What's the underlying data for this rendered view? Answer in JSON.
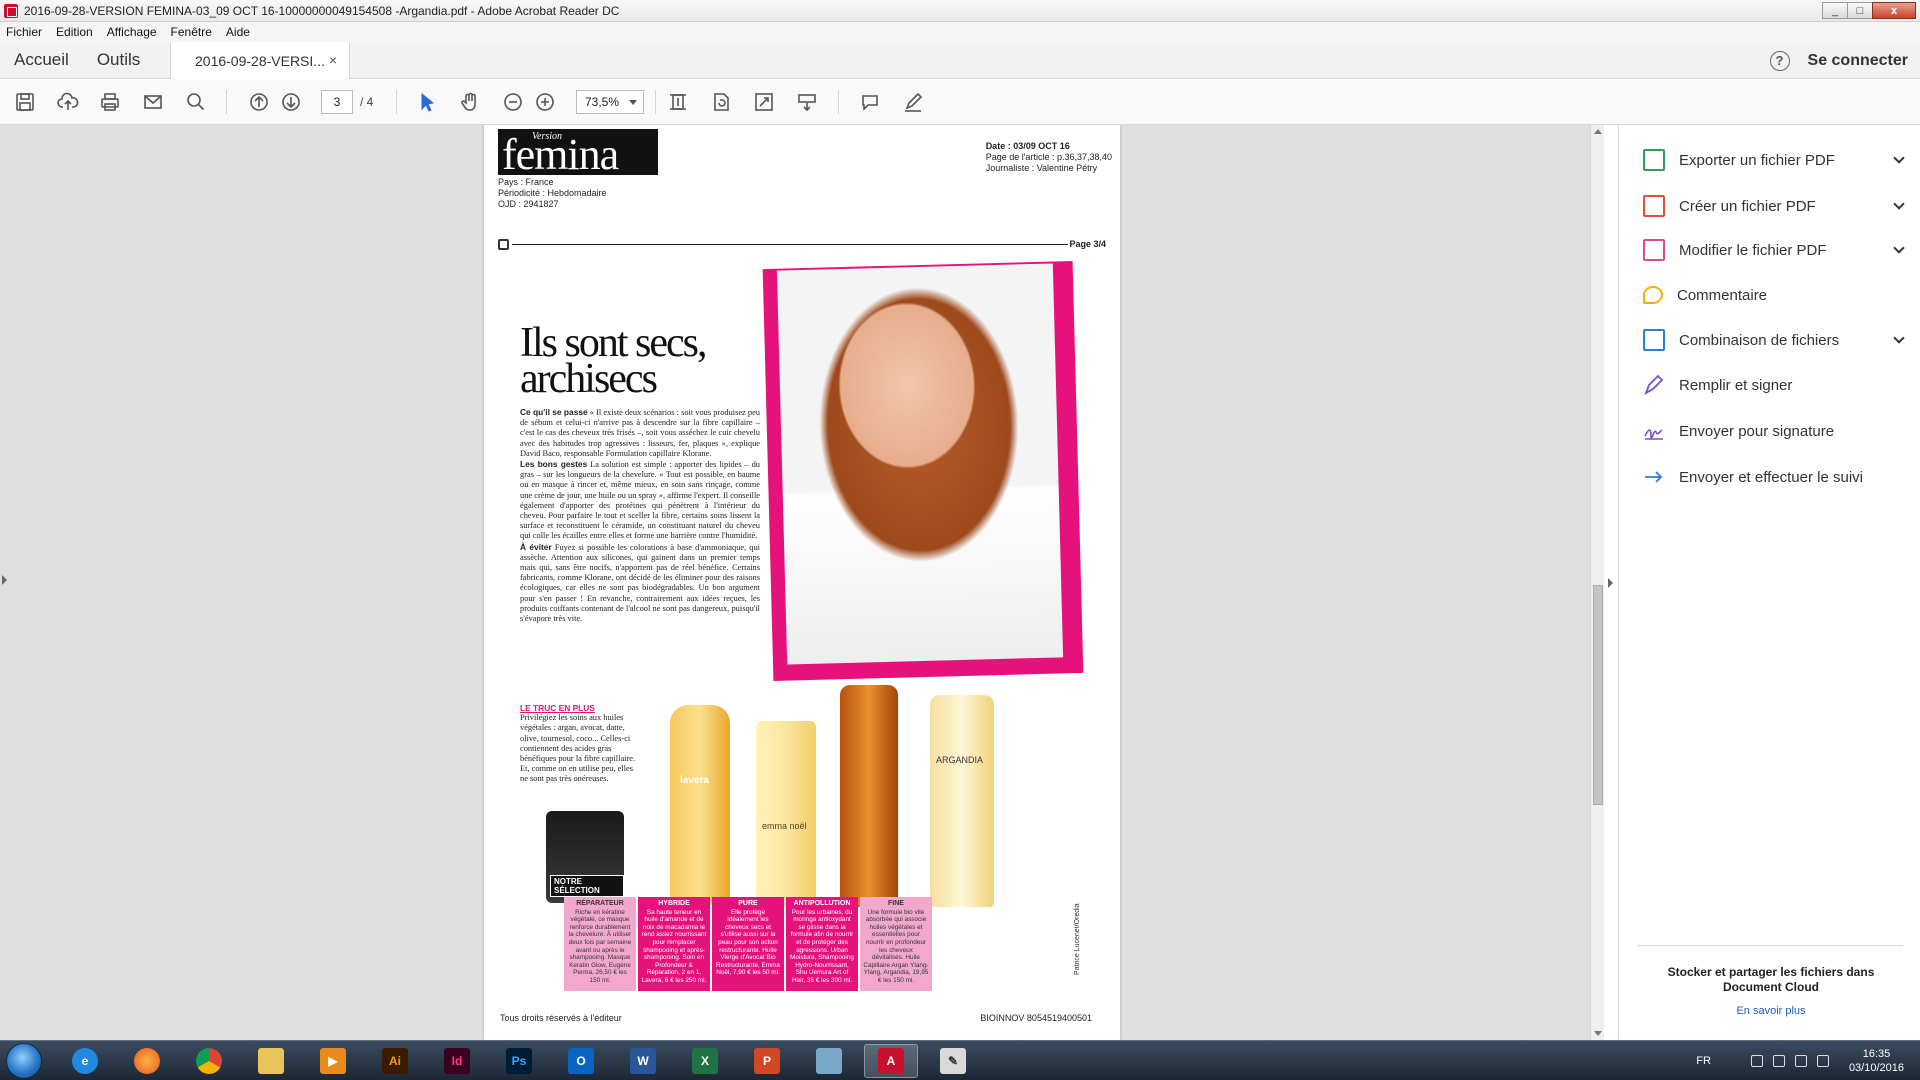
{
  "window": {
    "title": "2016-09-28-VERSION FEMINA-03_09 OCT 16-10000000049154508 -Argandia.pdf - Adobe Acrobat Reader DC",
    "controls": [
      "_",
      "□",
      "x"
    ]
  },
  "menu": [
    "Fichier",
    "Edition",
    "Affichage",
    "Fenêtre",
    "Aide"
  ],
  "tabs": {
    "home": "Accueil",
    "tools": "Outils",
    "document": "2016-09-28-VERSI...",
    "close": "×",
    "help": "?",
    "signin": "Se connecter"
  },
  "toolbar": {
    "page_current": "3",
    "page_total": "/ 4",
    "zoom": "73,5%"
  },
  "pdf": {
    "magazine_version": "Version",
    "magazine_name": "femina",
    "meta_left": [
      "Pays : France",
      "Périodicité : Hebdomadaire",
      "OJD : 2941827"
    ],
    "meta_right": {
      "date": "Date : 03/09 OCT 16",
      "page": "Page de l'article : p.36,37,38,40",
      "journalist": "Journaliste : Valentine Pétry"
    },
    "page_label": "Page 3/4",
    "headline_1": "Ils sont secs,",
    "headline_2": "archisecs",
    "section1_title": "Ce qu'il se passe",
    "section1_text": " « Il existe deux scénarios : soit vous produisez peu de sébum et celui-ci n'arrive pas à descendre sur la fibre capillaire – c'est le cas des cheveux très frisés –, soit vous asséchez le cuir chevelu avec des habitudes trop agressives : lisseurs, fer, plaques », explique David Baco, responsable Formulation capillaire Klorane.",
    "section2_title": "Les bons gestes",
    "section2_text": " La solution est simple : apporter des lipides – du gras – sur les longueurs de la chevelure. « Tout est possible, en baume ou en masque à rincer et, même mieux, en soin sans rinçage, comme une crème de jour, une huile ou un spray », affirme l'expert. Il conseille également d'apporter des protéines qui pénètrent à l'intérieur du cheveu. Pour parfaire le tout et sceller la fibre, certains soins lissent la surface et reconstituent le céramide, un constituant naturel du cheveu qui colle les écailles entre elles et forme une barrière contre l'humidité.",
    "section3_title": "À éviter",
    "section3_text": " Fuyez si possible les colorations à base d'ammoniaque, qui assèche. Attention aux silicones, qui gainent dans un premier temps mais qui, sans être nocifs, n'apportent pas de réel bénéfice. Certains fabricants, comme Klorane, ont décidé de les éliminer pour des raisons écologiques, car elles ne sont pas biodégradables. Un bon argument pour s'en passer ! En revanche, contrairement aux idées reçues, les produits coiffants contenant de l'alcool ne sont pas dangereux, puisqu'il s'évapore très vite.",
    "truc_title": "LE TRUC EN PLUS",
    "truc_text": "Privilégiez les soins aux huiles végétales : argan, avocat, datte, olive, tournesol, coco... Celles-ci contiennent des acides gras bénéfiques pour la fibre capillaire. Et, comme on en utilise peu, elles ne sont pas très onéreuses.",
    "selection_label": "NOTRE SÉLECTION",
    "cards": [
      {
        "title": "RÉPARATEUR",
        "text": "Riche en kératine végétale, ce masque renforce durablement la chevelure. À utiliser deux fois par semaine avant ou après le shampooing. Masque Keratin Glow, Eugène Perma, 26,50 € les 150 ml."
      },
      {
        "title": "HYBRIDE",
        "text": "Sa haute teneur en huile d'amande et de noix de macadamia le rend assez nourrissant pour remplacer shampooing et après-shampooing. Soin en Profondeur & Réparation, 2 en 1, Lavera, 6 € les 250 ml."
      },
      {
        "title": "PURE",
        "text": "Elle protège idéalement les cheveux secs et s'utilise aussi sur la peau pour son action restructurante. Huile Vierge d'Avocat Bio Restructurante, Emma Noël, 7,90 € les 50 ml."
      },
      {
        "title": "ANTIPOLLUTION",
        "text": "Pour les urbaines, du moringa antioxydant se glisse dans la formule afin de nourrir et de protéger des agressions. Urban Moisture, Shampooing Hydro-Nourrissant, Shu Uemura Art of Hair, 36 € les 300 ml."
      },
      {
        "title": "FINE",
        "text": "Une formule bio vite absorbée qui associe huiles végétales et essentielles pour nourrir en profondeur les cheveux dévitalisés. Huile Capillaire Argan Ylang-Ylang, Argandia, 19,95 € les 150 ml."
      }
    ],
    "product_labels": [
      "lavera",
      "emma noël",
      "ARGANDIA"
    ],
    "credit": "Patrice Lucenet/Oredia",
    "footer_left": "Tous droits réservés à l'éditeur",
    "footer_right": "BIOINNOV 8054519400501"
  },
  "right_pane": {
    "items": [
      {
        "label": "Exporter un fichier PDF",
        "color": "#2e9d5b",
        "chevron": true
      },
      {
        "label": "Créer un fichier PDF",
        "color": "#e0523b",
        "chevron": true
      },
      {
        "label": "Modifier le fichier PDF",
        "color": "#d84d9b",
        "chevron": true
      },
      {
        "label": "Commentaire",
        "color": "#f0b400",
        "chevron": false
      },
      {
        "label": "Combinaison de fichiers",
        "color": "#2a7fd4",
        "chevron": true
      },
      {
        "label": "Remplir et signer",
        "color": "#7b4fc6",
        "chevron": false
      },
      {
        "label": "Envoyer pour signature",
        "color": "#7b4fc6",
        "chevron": false
      },
      {
        "label": "Envoyer et effectuer le suivi",
        "color": "#2a7fd4",
        "chevron": false
      }
    ],
    "store_text": "Stocker et partager les fichiers dans Document Cloud",
    "learn_more": "En savoir plus"
  },
  "taskbar": {
    "lang": "FR",
    "time": "16:35",
    "date": "03/10/2016"
  }
}
